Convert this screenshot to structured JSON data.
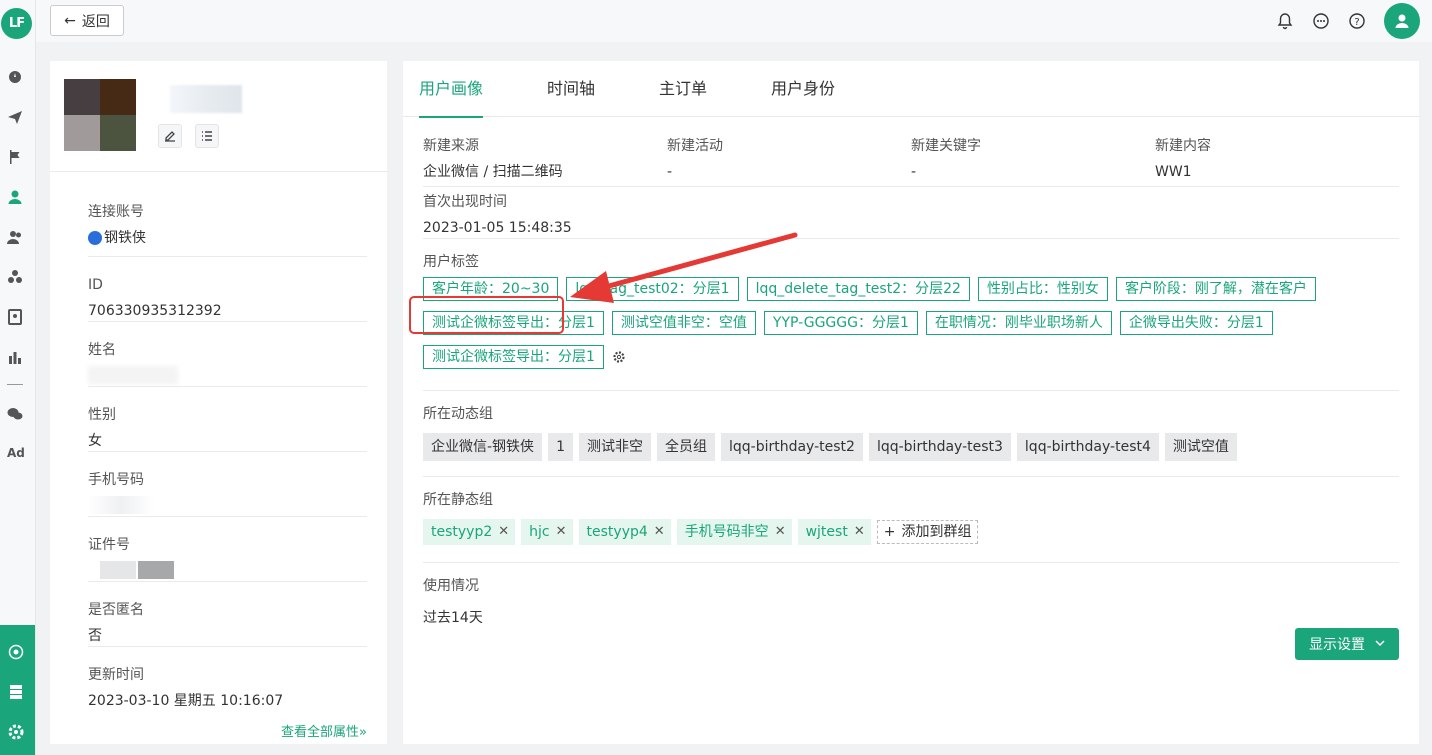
{
  "rail": {
    "logo": "LF",
    "ad_label": "Ad"
  },
  "topbar": {
    "back_label": "返回"
  },
  "profile": {
    "attributes": [
      {
        "label": "连接账号",
        "value": "钢铁侠"
      },
      {
        "label": "ID",
        "value": "706330935312392"
      },
      {
        "label": "姓名",
        "value": ""
      },
      {
        "label": "性别",
        "value": "女"
      },
      {
        "label": "手机号码",
        "value": ""
      },
      {
        "label": "证件号",
        "value": ""
      },
      {
        "label": "是否匿名",
        "value": "否"
      },
      {
        "label": "更新时间",
        "value": "2023-03-10 星期五 10:16:07"
      }
    ],
    "view_all": "查看全部属性"
  },
  "tabs": [
    "用户画像",
    "时间轴",
    "主订单",
    "用户身份"
  ],
  "overview": {
    "fields": [
      {
        "label": "新建来源",
        "value": "企业微信 / 扫描二维码"
      },
      {
        "label": "新建活动",
        "value": "-"
      },
      {
        "label": "新建关键字",
        "value": "-"
      },
      {
        "label": "新建内容",
        "value": "WW1"
      }
    ],
    "first_seen": {
      "label": "首次出现时间",
      "value": "2023-01-05 15:48:35"
    }
  },
  "user_tags": {
    "label": "用户标签",
    "tags": [
      "客户年龄：20~30",
      "lqq_tag_test02：分层1",
      "lqq_delete_tag_test2：分层22",
      "性别占比：性别女",
      "客户阶段：刚了解，潜在客户",
      "测试企微标签导出：分层1",
      "测试空值非空：空值",
      "YYP-GGGGG：分层1",
      "在职情况：刚毕业职场新人",
      "企微导出失败：分层1",
      "测试企微标签导出：分层1"
    ]
  },
  "dynamic_groups": {
    "label": "所在动态组",
    "groups": [
      "企业微信-钢铁侠",
      "1",
      "测试非空",
      "全员组",
      "lqq-birthday-test2",
      "lqq-birthday-test3",
      "lqq-birthday-test4",
      "测试空值"
    ]
  },
  "static_groups": {
    "label": "所在静态组",
    "groups": [
      "testyyp2",
      "hjc",
      "testyyp4",
      "手机号码非空",
      "wjtest"
    ],
    "add_label": "添加到群组"
  },
  "usage": {
    "label": "使用情况",
    "period": "过去14天",
    "settings_button": "显示设置"
  },
  "colors": {
    "accent": "#1aa67a",
    "highlight": "#e53935"
  }
}
